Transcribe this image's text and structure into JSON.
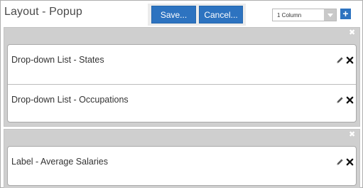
{
  "header": {
    "title": "Layout - Popup",
    "save_label": "Save...",
    "cancel_label": "Cancel...",
    "column_select": {
      "selected": "1 Column"
    },
    "add_icon": "plus-icon"
  },
  "sections": [
    {
      "items": [
        {
          "label": "Drop-down List - States"
        },
        {
          "label": "Drop-down List - Occupations"
        }
      ]
    },
    {
      "items": [
        {
          "label": "Label - Average Salaries"
        }
      ]
    }
  ],
  "icons": {
    "edit": "pencil-icon",
    "delete": "close-icon",
    "section_close": "close-icon"
  },
  "colors": {
    "accent": "#2d73c0",
    "section_bar": "#cfcfcf",
    "border": "#aeaeae"
  }
}
